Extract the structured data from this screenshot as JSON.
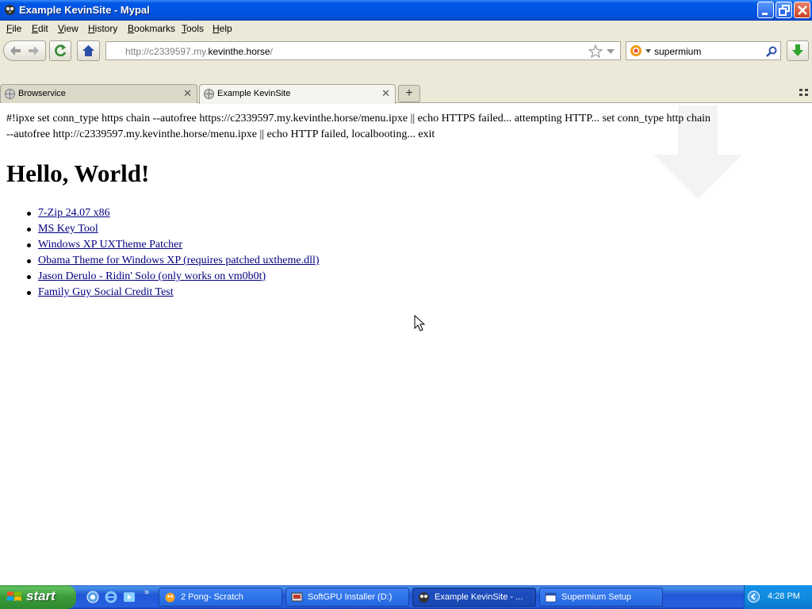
{
  "window": {
    "title": "Example KevinSite - Mypal"
  },
  "menubar": {
    "items": [
      "File",
      "Edit",
      "View",
      "History",
      "Bookmarks",
      "Tools",
      "Help"
    ]
  },
  "navbar": {
    "url_prefix": "http://c2339597.my.",
    "url_domain": "kevinthe.horse",
    "url_suffix": "/",
    "search_query": "supermium"
  },
  "tabs": [
    {
      "label": "Browservice",
      "active": false
    },
    {
      "label": "Example KevinSite",
      "active": true
    }
  ],
  "page": {
    "ipxe_line1": "#!ipxe set conn_type https chain --autofree https://c2339597.my.kevinthe.horse/menu.ipxe || echo HTTPS failed... attempting HTTP... set conn_type http chain",
    "ipxe_line2": "--autofree http://c2339597.my.kevinthe.horse/menu.ipxe || echo HTTP failed, localbooting... exit",
    "heading": "Hello, World!",
    "links": [
      "7-Zip 24.07 x86",
      "MS Key Tool",
      "Windows XP UXTheme Patcher",
      "Obama Theme for Windows XP (requires patched uxtheme.dll)",
      "Jason Derulo - Ridin' Solo (only works on vm0b0t)",
      "Family Guy Social Credit Test"
    ]
  },
  "taskbar": {
    "start_label": "start",
    "tasks": [
      {
        "label": "2 Pong- Scratch",
        "icon": "scratch-icon"
      },
      {
        "label": "SoftGPU Installer (D:)",
        "icon": "installer-icon"
      },
      {
        "label": "Example KevinSite - ...",
        "icon": "mypal-icon"
      },
      {
        "label": "Supermium Setup",
        "icon": "setup-window-icon"
      }
    ],
    "clock": "4:28 PM"
  },
  "colors": {
    "titlebar": "#0054e3",
    "chrome": "#ece9d8",
    "link": "#00007f",
    "taskbar": "#2157d7",
    "start": "#3a9a3a"
  }
}
